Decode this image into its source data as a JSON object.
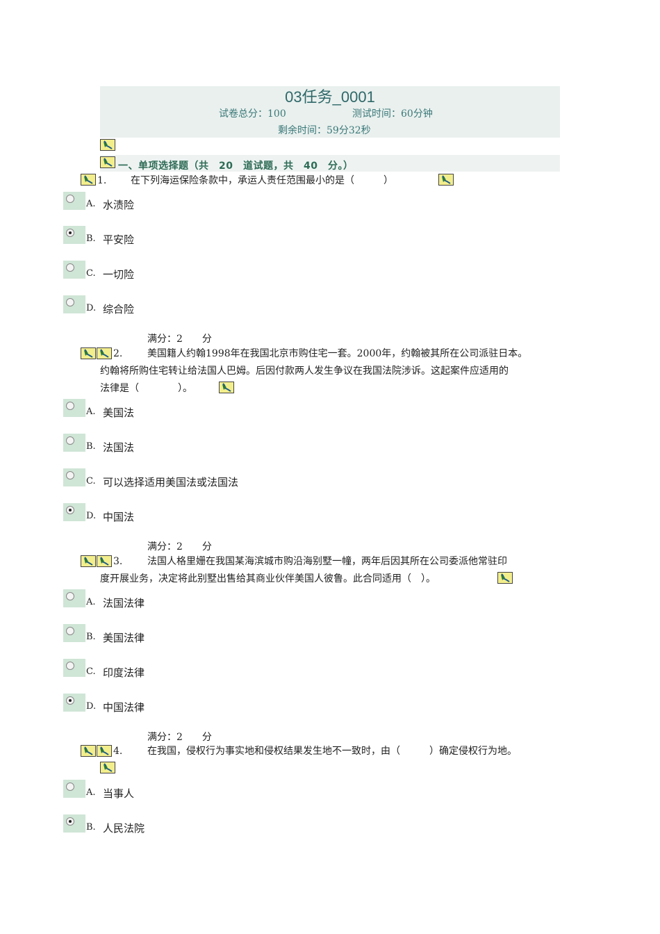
{
  "header": {
    "title": "03任务_0001",
    "total_score": "试卷总分：100",
    "test_time": "测试时间：60分钟",
    "remaining_time": "剩余时间：59分32秒"
  },
  "section": {
    "title": "一、单项选择题（共　20　道试题，共　40　分。）"
  },
  "questions": [
    {
      "number": "1.",
      "text": "在下列海运保险条款中，承运人责任范围最小的是（　　　）",
      "options": [
        {
          "letter": "A.",
          "text": "水渍险",
          "selected": false
        },
        {
          "letter": "B.",
          "text": "平安险",
          "selected": true
        },
        {
          "letter": "C.",
          "text": "一切险",
          "selected": false
        },
        {
          "letter": "D.",
          "text": "综合险",
          "selected": false
        }
      ],
      "score_label": "满分：2　　分"
    },
    {
      "number": "2.",
      "line1": "美国籍人约翰1998年在我国北京市购住宅一套。2000年，约翰被其所在公司派驻日本。",
      "line2": "约翰将所购住宅转让给法国人巴姆。后因付款两人发生争议在我国法院涉诉。这起案件应适用的",
      "line3": "法律是（　　　　）。",
      "options": [
        {
          "letter": "A.",
          "text": "美国法",
          "selected": false
        },
        {
          "letter": "B.",
          "text": "法国法",
          "selected": false
        },
        {
          "letter": "C.",
          "text": "可以选择适用美国法或法国法",
          "selected": false
        },
        {
          "letter": "D.",
          "text": "中国法",
          "selected": true
        }
      ],
      "score_label": "满分：2　　分"
    },
    {
      "number": "3.",
      "line1": "法国人格里姗在我国某海滨城市购沿海别墅一幢，两年后因其所在公司委派他常驻印",
      "line2": "度开展业务，决定将此别墅出售给其商业伙伴美国人彼鲁。此合同适用（　）。",
      "options": [
        {
          "letter": "A.",
          "text": "法国法律",
          "selected": false
        },
        {
          "letter": "B.",
          "text": "美国法律",
          "selected": false
        },
        {
          "letter": "C.",
          "text": "印度法律",
          "selected": false
        },
        {
          "letter": "D.",
          "text": "中国法律",
          "selected": true
        }
      ],
      "score_label": "满分：2　　分"
    },
    {
      "number": "4.",
      "line1": "在我国，侵权行为事实地和侵权结果发生地不一致时，由（　　　）确定侵权行为地。",
      "options": [
        {
          "letter": "A.",
          "text": "当事人",
          "selected": false
        },
        {
          "letter": "B.",
          "text": "人民法院",
          "selected": true
        }
      ]
    }
  ],
  "icons": {
    "flag": "marker-flag-icon",
    "radio": "radio-button-icon"
  },
  "colors": {
    "title": "#2f6868",
    "header_bg": "#e9f0ee",
    "section_text": "#2d6b55",
    "radio_bg": "#cfe5d6",
    "flag_bg": "#f3ee8c"
  }
}
